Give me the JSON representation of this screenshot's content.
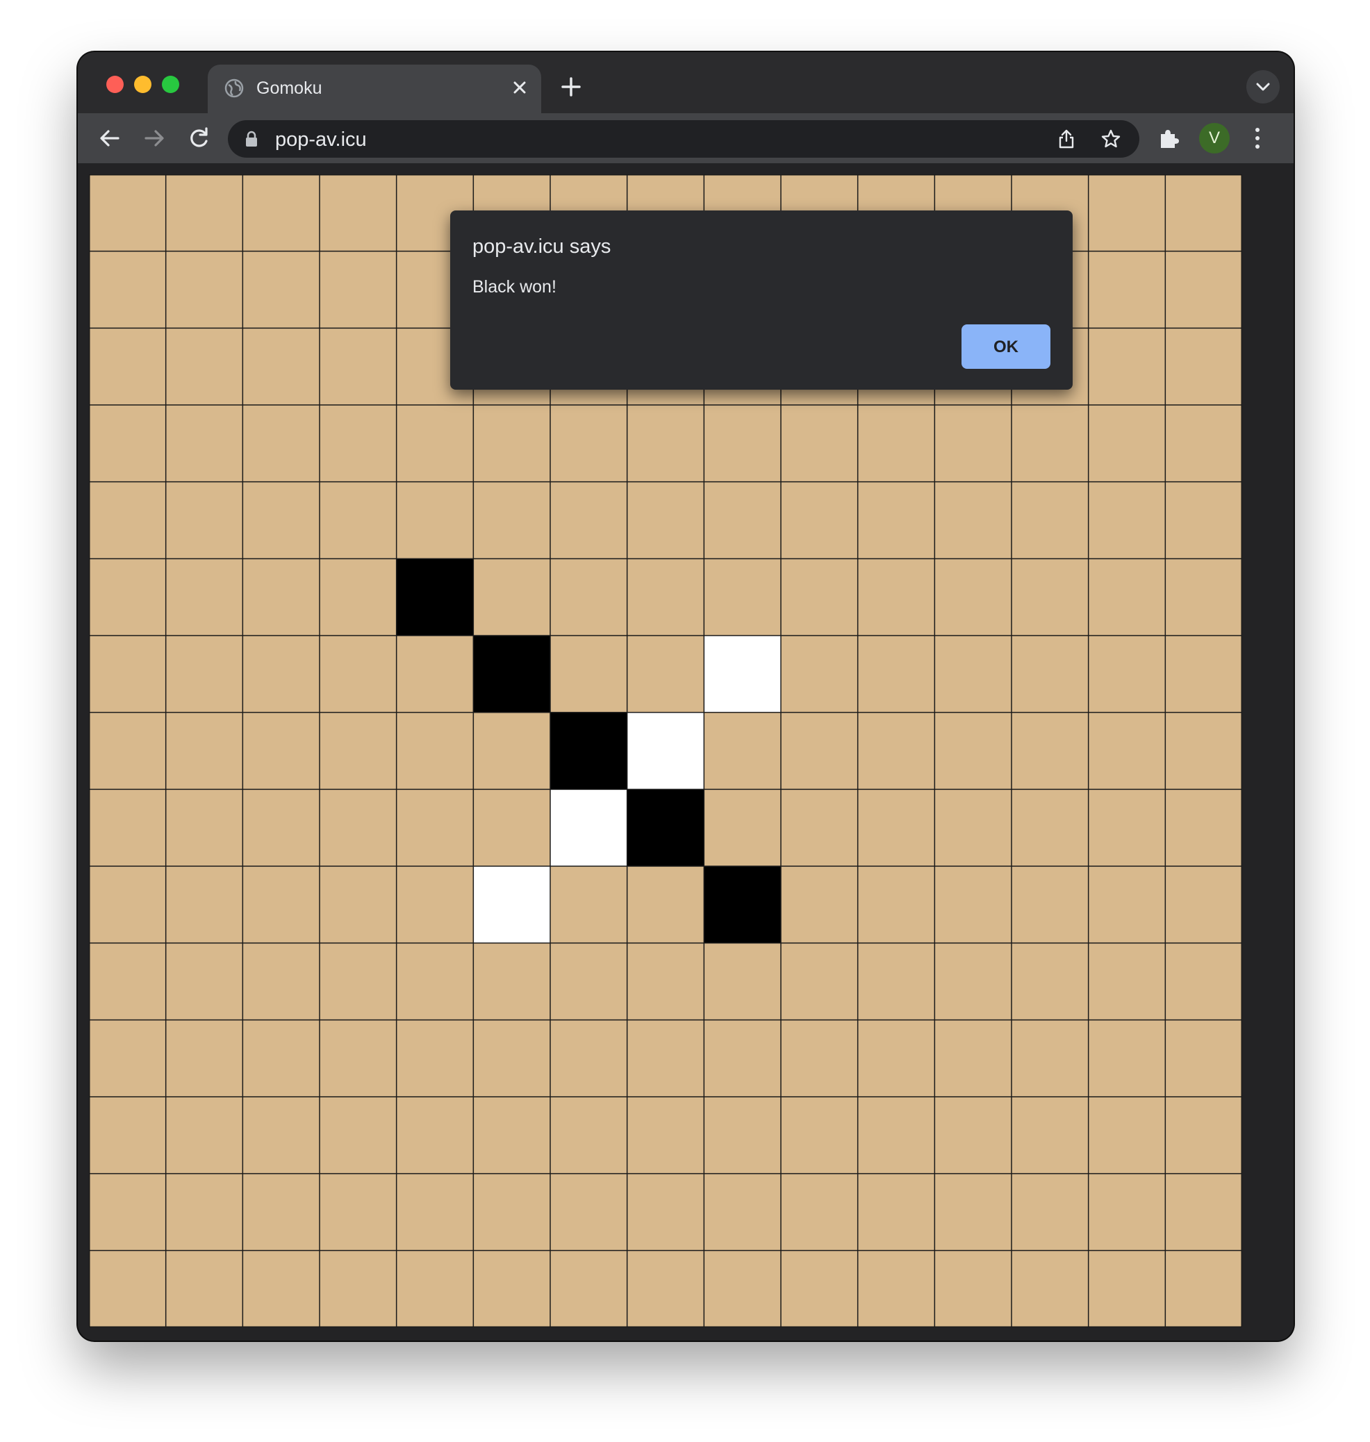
{
  "browser": {
    "tab": {
      "title": "Gomoku",
      "favicon": "globe-icon"
    },
    "address_bar": {
      "url": "pop-av.icu"
    },
    "profile": {
      "initial": "V",
      "color": "#3c6b27"
    }
  },
  "dialog": {
    "title": "pop-av.icu says",
    "message": "Black won!",
    "ok_label": "OK"
  },
  "game": {
    "size": 15,
    "board_color": "#d8b98d",
    "black_color": "#000000",
    "white_color": "#ffffff",
    "stones": [
      {
        "row": 5,
        "col": 4,
        "color": "black"
      },
      {
        "row": 6,
        "col": 5,
        "color": "black"
      },
      {
        "row": 6,
        "col": 8,
        "color": "white"
      },
      {
        "row": 7,
        "col": 6,
        "color": "black"
      },
      {
        "row": 7,
        "col": 7,
        "color": "white"
      },
      {
        "row": 8,
        "col": 6,
        "color": "white"
      },
      {
        "row": 8,
        "col": 7,
        "color": "black"
      },
      {
        "row": 9,
        "col": 5,
        "color": "white"
      },
      {
        "row": 9,
        "col": 8,
        "color": "black"
      }
    ]
  }
}
